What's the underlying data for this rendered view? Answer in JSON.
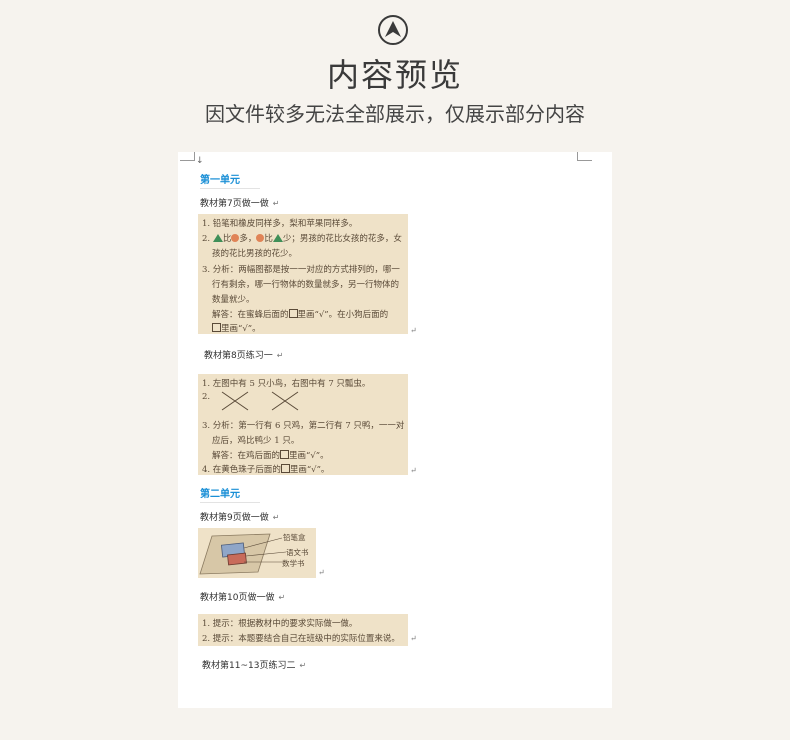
{
  "header": {
    "icon": "up-arrow-circle-icon",
    "title": "内容预览",
    "subtitle": "因文件较多无法全部展示，仅展示部分内容"
  },
  "document": {
    "return_mark": "↵",
    "arrow_mark": "↓",
    "unit1": {
      "heading": "第一单元",
      "sec1_title": "教材第7页做一做",
      "sec1_lines": [
        "1. 铅笔和橡皮同样多，梨和苹果同样多。",
        "2.",
        "比",
        "多，",
        "比",
        "少；男孩的花比女孩的花多，女",
        "孩的花比男孩的花少。",
        "3. 分析：两幅图都是按一一对应的方式排列的，哪一",
        "行有剩余，哪一行物体的数量就多，另一行物体的",
        "数量就少。",
        "解答：在蜜蜂后面的",
        "里画“√”。在小狗后面的",
        "里画“√”。"
      ],
      "sec2_title": "教材第8页练习一",
      "sec2_lines": [
        "1. 左图中有 5 只小鸟，右图中有 7 只瓢虫。",
        "2.",
        "3. 分析：第一行有 6 只鸡，第二行有 7 只鸭，一一对",
        "应后，鸡比鸭少 1 只。",
        "解答：在鸡后面的",
        "里画“√”。",
        "4. 在黄色珠子后面的",
        "里画“√”。"
      ]
    },
    "unit2": {
      "heading": "第二单元",
      "sec1_title": "教材第9页做一做",
      "illustration_labels": [
        "铅笔盒",
        "语文书",
        "数学书"
      ],
      "sec2_title": "教材第10页做一做",
      "sec2_lines": [
        "1. 提示：根据教材中的要求实际做一做。",
        "2. 提示：本题要结合自己在班级中的实际位置来说。"
      ],
      "sec3_title": "教材第11~13页练习二"
    }
  },
  "colors": {
    "background": "#f6f3ee",
    "unit_heading": "#1a8fd6",
    "panel": "#efe2c8"
  }
}
